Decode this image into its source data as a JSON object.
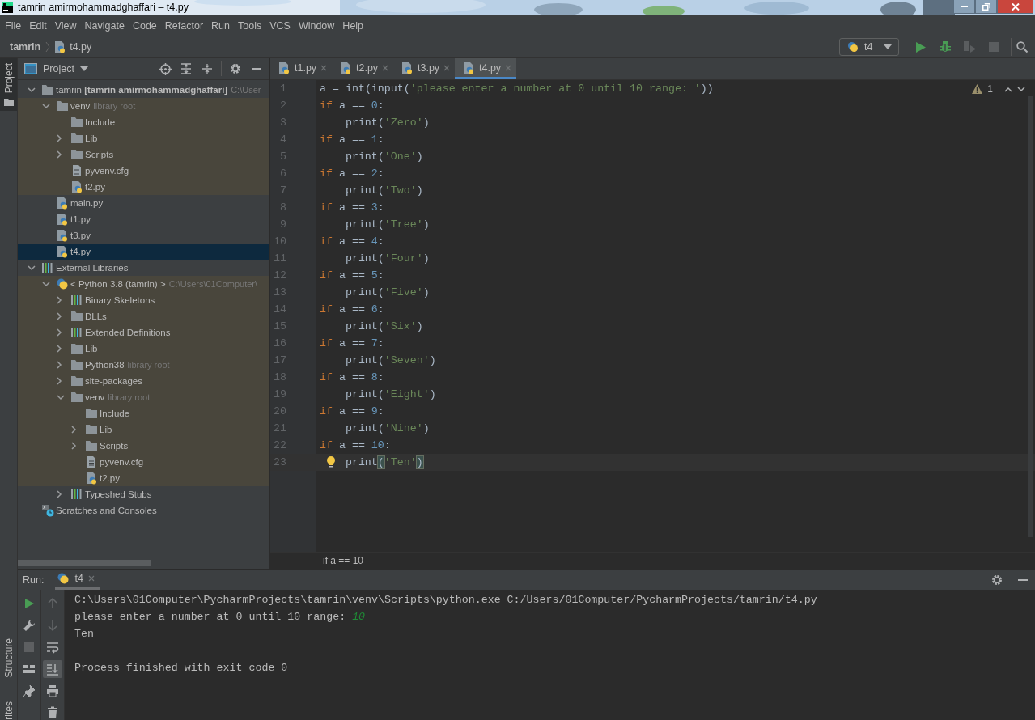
{
  "window": {
    "title": "tamrin amirmohammadghaffari – t4.py"
  },
  "menu": [
    "File",
    "Edit",
    "View",
    "Navigate",
    "Code",
    "Refactor",
    "Run",
    "Tools",
    "VCS",
    "Window",
    "Help"
  ],
  "nav_bar": {
    "project": "tamrin",
    "file": "t4.py",
    "run_config": "t4"
  },
  "toolbar": [
    {
      "kind": "run",
      "disabled": false
    },
    {
      "kind": "debug",
      "disabled": false
    },
    {
      "kind": "coverage",
      "disabled": true
    },
    {
      "kind": "stop",
      "disabled": true
    },
    {
      "kind": "search",
      "disabled": false
    }
  ],
  "left_stripe": {
    "top": [
      {
        "label": "Project",
        "selected": true
      }
    ],
    "bottom": [
      {
        "label": "Structure",
        "selected": false
      },
      {
        "label": "rites",
        "selected": false
      }
    ]
  },
  "project_panel": {
    "title": "Project"
  },
  "project_tree": [
    {
      "label": "tamrin **[tamrin amirmohammadghaffari]**",
      "hint": "C:\\User",
      "kind": "folder",
      "expanded": true,
      "tinted": false,
      "selected": false,
      "children": [
        {
          "label": "venv",
          "hint": "library root",
          "kind": "folder",
          "expanded": true,
          "tinted": true,
          "selected": false,
          "children": [
            {
              "label": "Include",
              "kind": "folder",
              "tinted": true,
              "selected": false
            },
            {
              "label": "Lib",
              "kind": "folder",
              "expanded": false,
              "tinted": true,
              "selected": false
            },
            {
              "label": "Scripts",
              "kind": "folder",
              "expanded": false,
              "tinted": true,
              "selected": false
            },
            {
              "label": "pyvenv.cfg",
              "kind": "file",
              "tinted": true,
              "selected": false
            },
            {
              "label": "t2.py",
              "kind": "python",
              "tinted": true,
              "selected": false
            }
          ]
        },
        {
          "label": "main.py",
          "kind": "python",
          "tinted": false,
          "selected": false
        },
        {
          "label": "t1.py",
          "kind": "python",
          "tinted": false,
          "selected": false
        },
        {
          "label": "t3.py",
          "kind": "python",
          "tinted": false,
          "selected": false
        },
        {
          "label": "t4.py",
          "kind": "python",
          "tinted": false,
          "selected": true
        }
      ]
    },
    {
      "label": "External Libraries",
      "kind": "library",
      "expanded": true,
      "tinted": false,
      "selected": false,
      "children": [
        {
          "label": "< Python 3.8 (tamrin) >",
          "hint": "C:\\Users\\01Computer\\",
          "kind": "sdk",
          "expanded": true,
          "tinted": true,
          "selected": false,
          "children": [
            {
              "label": "Binary Skeletons",
              "kind": "library",
              "expanded": false,
              "tinted": true,
              "selected": false
            },
            {
              "label": "DLLs",
              "kind": "folder",
              "expanded": false,
              "tinted": true,
              "selected": false
            },
            {
              "label": "Extended Definitions",
              "kind": "library",
              "expanded": false,
              "tinted": true,
              "selected": false
            },
            {
              "label": "Lib",
              "kind": "folder",
              "expanded": false,
              "tinted": true,
              "selected": false
            },
            {
              "label": "Python38",
              "hint": "library root",
              "kind": "folder",
              "expanded": false,
              "tinted": true,
              "selected": false
            },
            {
              "label": "site-packages",
              "kind": "folder",
              "expanded": false,
              "tinted": true,
              "selected": false
            },
            {
              "label": "venv",
              "hint": "library root",
              "kind": "folder",
              "expanded": true,
              "tinted": true,
              "selected": false,
              "children": [
                {
                  "label": "Include",
                  "kind": "folder",
                  "tinted": true,
                  "selected": false
                },
                {
                  "label": "Lib",
                  "kind": "folder",
                  "expanded": false,
                  "tinted": true,
                  "selected": false
                },
                {
                  "label": "Scripts",
                  "kind": "folder",
                  "expanded": false,
                  "tinted": true,
                  "selected": false
                },
                {
                  "label": "pyvenv.cfg",
                  "kind": "file",
                  "tinted": true,
                  "selected": false
                },
                {
                  "label": "t2.py",
                  "kind": "python",
                  "tinted": true,
                  "selected": false
                }
              ]
            },
            {
              "label": "Typeshed Stubs",
              "kind": "library",
              "expanded": false,
              "tinted": false,
              "selected": false
            }
          ]
        }
      ]
    },
    {
      "label": "Scratches and Consoles",
      "kind": "scratch",
      "tinted": false,
      "selected": false
    }
  ],
  "tabs": [
    {
      "label": "t1.py",
      "selected": false
    },
    {
      "label": "t2.py",
      "selected": false
    },
    {
      "label": "t3.py",
      "selected": false
    },
    {
      "label": "t4.py",
      "selected": true
    }
  ],
  "editor": {
    "warnings": "1",
    "breadcrumb": "if a == 10",
    "lines": [
      {
        "n": "1",
        "current": false,
        "tokens": [
          {
            "t": "a = ",
            "kind": "plain"
          },
          {
            "t": "int",
            "kind": "builtin"
          },
          {
            "t": "(",
            "kind": "plain"
          },
          {
            "t": "input",
            "kind": "builtin"
          },
          {
            "t": "(",
            "kind": "plain"
          },
          {
            "t": "'please enter a number at 0 until 10 range: '",
            "kind": "string"
          },
          {
            "t": "))",
            "kind": "plain"
          }
        ]
      },
      {
        "n": "2",
        "current": false,
        "tokens": [
          {
            "t": "if",
            "kind": "keyword"
          },
          {
            "t": " a == ",
            "kind": "plain"
          },
          {
            "t": "0",
            "kind": "number"
          },
          {
            "t": ":",
            "kind": "plain"
          }
        ]
      },
      {
        "n": "3",
        "current": false,
        "tokens": [
          {
            "t": "    print(",
            "kind": "plain"
          },
          {
            "t": "'Zero'",
            "kind": "string"
          },
          {
            "t": ")",
            "kind": "plain"
          }
        ]
      },
      {
        "n": "4",
        "current": false,
        "tokens": [
          {
            "t": "if",
            "kind": "keyword"
          },
          {
            "t": " a == ",
            "kind": "plain"
          },
          {
            "t": "1",
            "kind": "number"
          },
          {
            "t": ":",
            "kind": "plain"
          }
        ]
      },
      {
        "n": "5",
        "current": false,
        "tokens": [
          {
            "t": "    print(",
            "kind": "plain"
          },
          {
            "t": "'One'",
            "kind": "string"
          },
          {
            "t": ")",
            "kind": "plain"
          }
        ]
      },
      {
        "n": "6",
        "current": false,
        "tokens": [
          {
            "t": "if",
            "kind": "keyword"
          },
          {
            "t": " a == ",
            "kind": "plain"
          },
          {
            "t": "2",
            "kind": "number"
          },
          {
            "t": ":",
            "kind": "plain"
          }
        ]
      },
      {
        "n": "7",
        "current": false,
        "tokens": [
          {
            "t": "    print(",
            "kind": "plain"
          },
          {
            "t": "'Two'",
            "kind": "string"
          },
          {
            "t": ")",
            "kind": "plain"
          }
        ]
      },
      {
        "n": "8",
        "current": false,
        "tokens": [
          {
            "t": "if",
            "kind": "keyword"
          },
          {
            "t": " a == ",
            "kind": "plain"
          },
          {
            "t": "3",
            "kind": "number"
          },
          {
            "t": ":",
            "kind": "plain"
          }
        ]
      },
      {
        "n": "9",
        "current": false,
        "tokens": [
          {
            "t": "    print(",
            "kind": "plain"
          },
          {
            "t": "'Tree'",
            "kind": "string"
          },
          {
            "t": ")",
            "kind": "plain"
          }
        ]
      },
      {
        "n": "10",
        "current": false,
        "tokens": [
          {
            "t": "if",
            "kind": "keyword"
          },
          {
            "t": " a == ",
            "kind": "plain"
          },
          {
            "t": "4",
            "kind": "number"
          },
          {
            "t": ":",
            "kind": "plain"
          }
        ]
      },
      {
        "n": "11",
        "current": false,
        "tokens": [
          {
            "t": "    print(",
            "kind": "plain"
          },
          {
            "t": "'Four'",
            "kind": "string"
          },
          {
            "t": ")",
            "kind": "plain"
          }
        ]
      },
      {
        "n": "12",
        "current": false,
        "tokens": [
          {
            "t": "if",
            "kind": "keyword"
          },
          {
            "t": " a == ",
            "kind": "plain"
          },
          {
            "t": "5",
            "kind": "number"
          },
          {
            "t": ":",
            "kind": "plain"
          }
        ]
      },
      {
        "n": "13",
        "current": false,
        "tokens": [
          {
            "t": "    print(",
            "kind": "plain"
          },
          {
            "t": "'Five'",
            "kind": "string"
          },
          {
            "t": ")",
            "kind": "plain"
          }
        ]
      },
      {
        "n": "14",
        "current": false,
        "tokens": [
          {
            "t": "if",
            "kind": "keyword"
          },
          {
            "t": " a == ",
            "kind": "plain"
          },
          {
            "t": "6",
            "kind": "number"
          },
          {
            "t": ":",
            "kind": "plain"
          }
        ]
      },
      {
        "n": "15",
        "current": false,
        "tokens": [
          {
            "t": "    print(",
            "kind": "plain"
          },
          {
            "t": "'Six'",
            "kind": "string"
          },
          {
            "t": ")",
            "kind": "plain"
          }
        ]
      },
      {
        "n": "16",
        "current": false,
        "tokens": [
          {
            "t": "if",
            "kind": "keyword"
          },
          {
            "t": " a == ",
            "kind": "plain"
          },
          {
            "t": "7",
            "kind": "number"
          },
          {
            "t": ":",
            "kind": "plain"
          }
        ]
      },
      {
        "n": "17",
        "current": false,
        "tokens": [
          {
            "t": "    print(",
            "kind": "plain"
          },
          {
            "t": "'Seven'",
            "kind": "string"
          },
          {
            "t": ")",
            "kind": "plain"
          }
        ]
      },
      {
        "n": "18",
        "current": false,
        "tokens": [
          {
            "t": "if",
            "kind": "keyword"
          },
          {
            "t": " a == ",
            "kind": "plain"
          },
          {
            "t": "8",
            "kind": "number"
          },
          {
            "t": ":",
            "kind": "plain"
          }
        ]
      },
      {
        "n": "19",
        "current": false,
        "tokens": [
          {
            "t": "    print(",
            "kind": "plain"
          },
          {
            "t": "'Eight'",
            "kind": "string"
          },
          {
            "t": ")",
            "kind": "plain"
          }
        ]
      },
      {
        "n": "20",
        "current": false,
        "tokens": [
          {
            "t": "if",
            "kind": "keyword"
          },
          {
            "t": " a == ",
            "kind": "plain"
          },
          {
            "t": "9",
            "kind": "number"
          },
          {
            "t": ":",
            "kind": "plain"
          }
        ]
      },
      {
        "n": "21",
        "current": false,
        "tokens": [
          {
            "t": "    print(",
            "kind": "plain"
          },
          {
            "t": "'Nine'",
            "kind": "string"
          },
          {
            "t": ")",
            "kind": "plain"
          }
        ]
      },
      {
        "n": "22",
        "current": false,
        "tokens": [
          {
            "t": "if",
            "kind": "keyword"
          },
          {
            "t": " a == ",
            "kind": "plain"
          },
          {
            "t": "10",
            "kind": "number"
          },
          {
            "t": ":",
            "kind": "plain"
          }
        ]
      },
      {
        "n": "23",
        "current": true,
        "tokens": [
          {
            "t": "    print",
            "kind": "plain"
          },
          {
            "t": "(",
            "kind": "brace_match"
          },
          {
            "t": "'Ten'",
            "kind": "string"
          },
          {
            "t": ")",
            "kind": "brace_match"
          }
        ]
      }
    ]
  },
  "run_panel": {
    "label": "Run:",
    "tab": "t4",
    "tools": [
      [
        {
          "kind": "run",
          "disabled": false,
          "selected": false
        },
        {
          "kind": "wrench",
          "disabled": false,
          "selected": false
        },
        {
          "kind": "stop",
          "disabled": true,
          "selected": false
        },
        {
          "kind": "layout",
          "disabled": false,
          "selected": false
        },
        {
          "kind": "pin",
          "disabled": false,
          "selected": false
        }
      ],
      [
        {
          "kind": "up",
          "disabled": true,
          "selected": false
        },
        {
          "kind": "down",
          "disabled": true,
          "selected": false
        },
        {
          "kind": "wrap",
          "disabled": false,
          "selected": false
        },
        {
          "kind": "scroll_end",
          "disabled": false,
          "selected": true
        },
        {
          "kind": "print",
          "disabled": false,
          "selected": false
        },
        {
          "kind": "trash",
          "disabled": false,
          "selected": false
        }
      ]
    ],
    "console": [
      {
        "kind": "output",
        "segments": [
          {
            "text": "C:\\Users\\01Computer\\PycharmProjects\\tamrin\\venv\\Scripts\\python.exe C:/Users/01Computer/PycharmProjects/tamrin/t4.py",
            "kind": "output"
          }
        ]
      },
      {
        "kind": "output",
        "segments": [
          {
            "text": "please enter a number at 0 until 10 range: ",
            "kind": "output"
          },
          {
            "text": "10",
            "kind": "input"
          }
        ]
      },
      {
        "kind": "output",
        "segments": [
          {
            "text": "Ten",
            "kind": "output"
          }
        ]
      },
      {
        "kind": "exit",
        "segments": [
          {
            "text": "Process finished with exit code 0",
            "kind": "output"
          }
        ]
      }
    ]
  }
}
